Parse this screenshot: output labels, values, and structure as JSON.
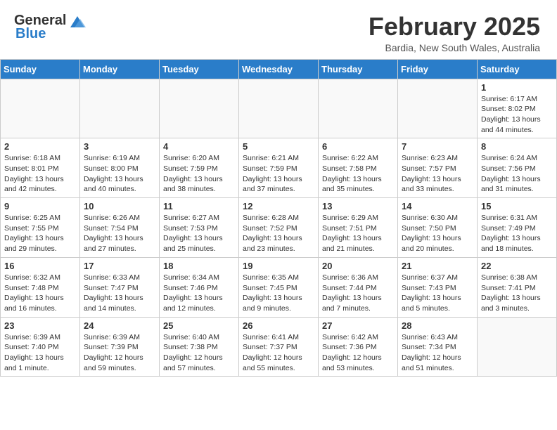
{
  "header": {
    "logo_general": "General",
    "logo_blue": "Blue",
    "month_title": "February 2025",
    "location": "Bardia, New South Wales, Australia"
  },
  "weekdays": [
    "Sunday",
    "Monday",
    "Tuesday",
    "Wednesday",
    "Thursday",
    "Friday",
    "Saturday"
  ],
  "weeks": [
    [
      {
        "day": "",
        "info": ""
      },
      {
        "day": "",
        "info": ""
      },
      {
        "day": "",
        "info": ""
      },
      {
        "day": "",
        "info": ""
      },
      {
        "day": "",
        "info": ""
      },
      {
        "day": "",
        "info": ""
      },
      {
        "day": "1",
        "info": "Sunrise: 6:17 AM\nSunset: 8:02 PM\nDaylight: 13 hours\nand 44 minutes."
      }
    ],
    [
      {
        "day": "2",
        "info": "Sunrise: 6:18 AM\nSunset: 8:01 PM\nDaylight: 13 hours\nand 42 minutes."
      },
      {
        "day": "3",
        "info": "Sunrise: 6:19 AM\nSunset: 8:00 PM\nDaylight: 13 hours\nand 40 minutes."
      },
      {
        "day": "4",
        "info": "Sunrise: 6:20 AM\nSunset: 7:59 PM\nDaylight: 13 hours\nand 38 minutes."
      },
      {
        "day": "5",
        "info": "Sunrise: 6:21 AM\nSunset: 7:59 PM\nDaylight: 13 hours\nand 37 minutes."
      },
      {
        "day": "6",
        "info": "Sunrise: 6:22 AM\nSunset: 7:58 PM\nDaylight: 13 hours\nand 35 minutes."
      },
      {
        "day": "7",
        "info": "Sunrise: 6:23 AM\nSunset: 7:57 PM\nDaylight: 13 hours\nand 33 minutes."
      },
      {
        "day": "8",
        "info": "Sunrise: 6:24 AM\nSunset: 7:56 PM\nDaylight: 13 hours\nand 31 minutes."
      }
    ],
    [
      {
        "day": "9",
        "info": "Sunrise: 6:25 AM\nSunset: 7:55 PM\nDaylight: 13 hours\nand 29 minutes."
      },
      {
        "day": "10",
        "info": "Sunrise: 6:26 AM\nSunset: 7:54 PM\nDaylight: 13 hours\nand 27 minutes."
      },
      {
        "day": "11",
        "info": "Sunrise: 6:27 AM\nSunset: 7:53 PM\nDaylight: 13 hours\nand 25 minutes."
      },
      {
        "day": "12",
        "info": "Sunrise: 6:28 AM\nSunset: 7:52 PM\nDaylight: 13 hours\nand 23 minutes."
      },
      {
        "day": "13",
        "info": "Sunrise: 6:29 AM\nSunset: 7:51 PM\nDaylight: 13 hours\nand 21 minutes."
      },
      {
        "day": "14",
        "info": "Sunrise: 6:30 AM\nSunset: 7:50 PM\nDaylight: 13 hours\nand 20 minutes."
      },
      {
        "day": "15",
        "info": "Sunrise: 6:31 AM\nSunset: 7:49 PM\nDaylight: 13 hours\nand 18 minutes."
      }
    ],
    [
      {
        "day": "16",
        "info": "Sunrise: 6:32 AM\nSunset: 7:48 PM\nDaylight: 13 hours\nand 16 minutes."
      },
      {
        "day": "17",
        "info": "Sunrise: 6:33 AM\nSunset: 7:47 PM\nDaylight: 13 hours\nand 14 minutes."
      },
      {
        "day": "18",
        "info": "Sunrise: 6:34 AM\nSunset: 7:46 PM\nDaylight: 13 hours\nand 12 minutes."
      },
      {
        "day": "19",
        "info": "Sunrise: 6:35 AM\nSunset: 7:45 PM\nDaylight: 13 hours\nand 9 minutes."
      },
      {
        "day": "20",
        "info": "Sunrise: 6:36 AM\nSunset: 7:44 PM\nDaylight: 13 hours\nand 7 minutes."
      },
      {
        "day": "21",
        "info": "Sunrise: 6:37 AM\nSunset: 7:43 PM\nDaylight: 13 hours\nand 5 minutes."
      },
      {
        "day": "22",
        "info": "Sunrise: 6:38 AM\nSunset: 7:41 PM\nDaylight: 13 hours\nand 3 minutes."
      }
    ],
    [
      {
        "day": "23",
        "info": "Sunrise: 6:39 AM\nSunset: 7:40 PM\nDaylight: 13 hours\nand 1 minute."
      },
      {
        "day": "24",
        "info": "Sunrise: 6:39 AM\nSunset: 7:39 PM\nDaylight: 12 hours\nand 59 minutes."
      },
      {
        "day": "25",
        "info": "Sunrise: 6:40 AM\nSunset: 7:38 PM\nDaylight: 12 hours\nand 57 minutes."
      },
      {
        "day": "26",
        "info": "Sunrise: 6:41 AM\nSunset: 7:37 PM\nDaylight: 12 hours\nand 55 minutes."
      },
      {
        "day": "27",
        "info": "Sunrise: 6:42 AM\nSunset: 7:36 PM\nDaylight: 12 hours\nand 53 minutes."
      },
      {
        "day": "28",
        "info": "Sunrise: 6:43 AM\nSunset: 7:34 PM\nDaylight: 12 hours\nand 51 minutes."
      },
      {
        "day": "",
        "info": ""
      }
    ]
  ]
}
